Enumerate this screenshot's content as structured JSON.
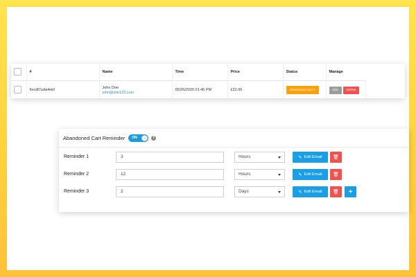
{
  "orders": {
    "columns": [
      "#",
      "Name",
      "Time",
      "Price",
      "Status",
      "Manage"
    ],
    "rows": [
      {
        "id": "5ecd01afa4ebf",
        "name": "John Doe",
        "email": "john@site123.com",
        "time": "05/26/2020 01:46 PM",
        "price": "£22.00",
        "status": "Abandoned Cart",
        "info_label": "Info",
        "delete_label": "Delete"
      }
    ]
  },
  "reminder": {
    "title": "Abandoned Cart Reminder",
    "toggle_label": "ON",
    "toggle_knob": "III",
    "help_icon": "?",
    "edit_label": "Edit Email",
    "rows": [
      {
        "label": "Reminder 1",
        "value": "3",
        "unit": "Hours"
      },
      {
        "label": "Reminder 2",
        "value": "12",
        "unit": "Hours"
      },
      {
        "label": "Reminder 3",
        "value": "2",
        "unit": "Days"
      }
    ]
  },
  "colors": {
    "background": "#ffd23f",
    "primary": "#1a9ee6",
    "danger": "#ef5350",
    "warning": "#ff9f0a",
    "muted": "#9d9d9d"
  }
}
